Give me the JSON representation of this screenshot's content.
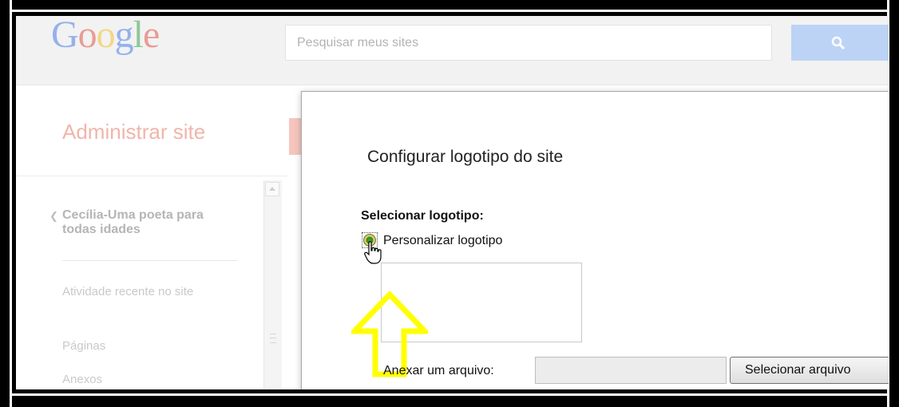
{
  "header": {
    "logo_text": "Google",
    "search_placeholder": "Pesquisar meus sites",
    "search_icon": "search-icon"
  },
  "sidebar": {
    "title": "Administrar site",
    "site_back_icon": "chevron-left-icon",
    "site_name": "Cecília-Uma poeta para todas idades",
    "items": [
      {
        "label": "Atividade recente no site"
      },
      {
        "label": "Páginas"
      },
      {
        "label": "Anexos"
      }
    ]
  },
  "dialog": {
    "title": "Configurar logotipo do site",
    "section_label": "Selecionar logotipo:",
    "radio_label": "Personalizar logotipo",
    "attach_label": "Anexar um arquivo:",
    "file_button_label": "Selecionar arquivo",
    "annotation_color": "#ffff00"
  }
}
